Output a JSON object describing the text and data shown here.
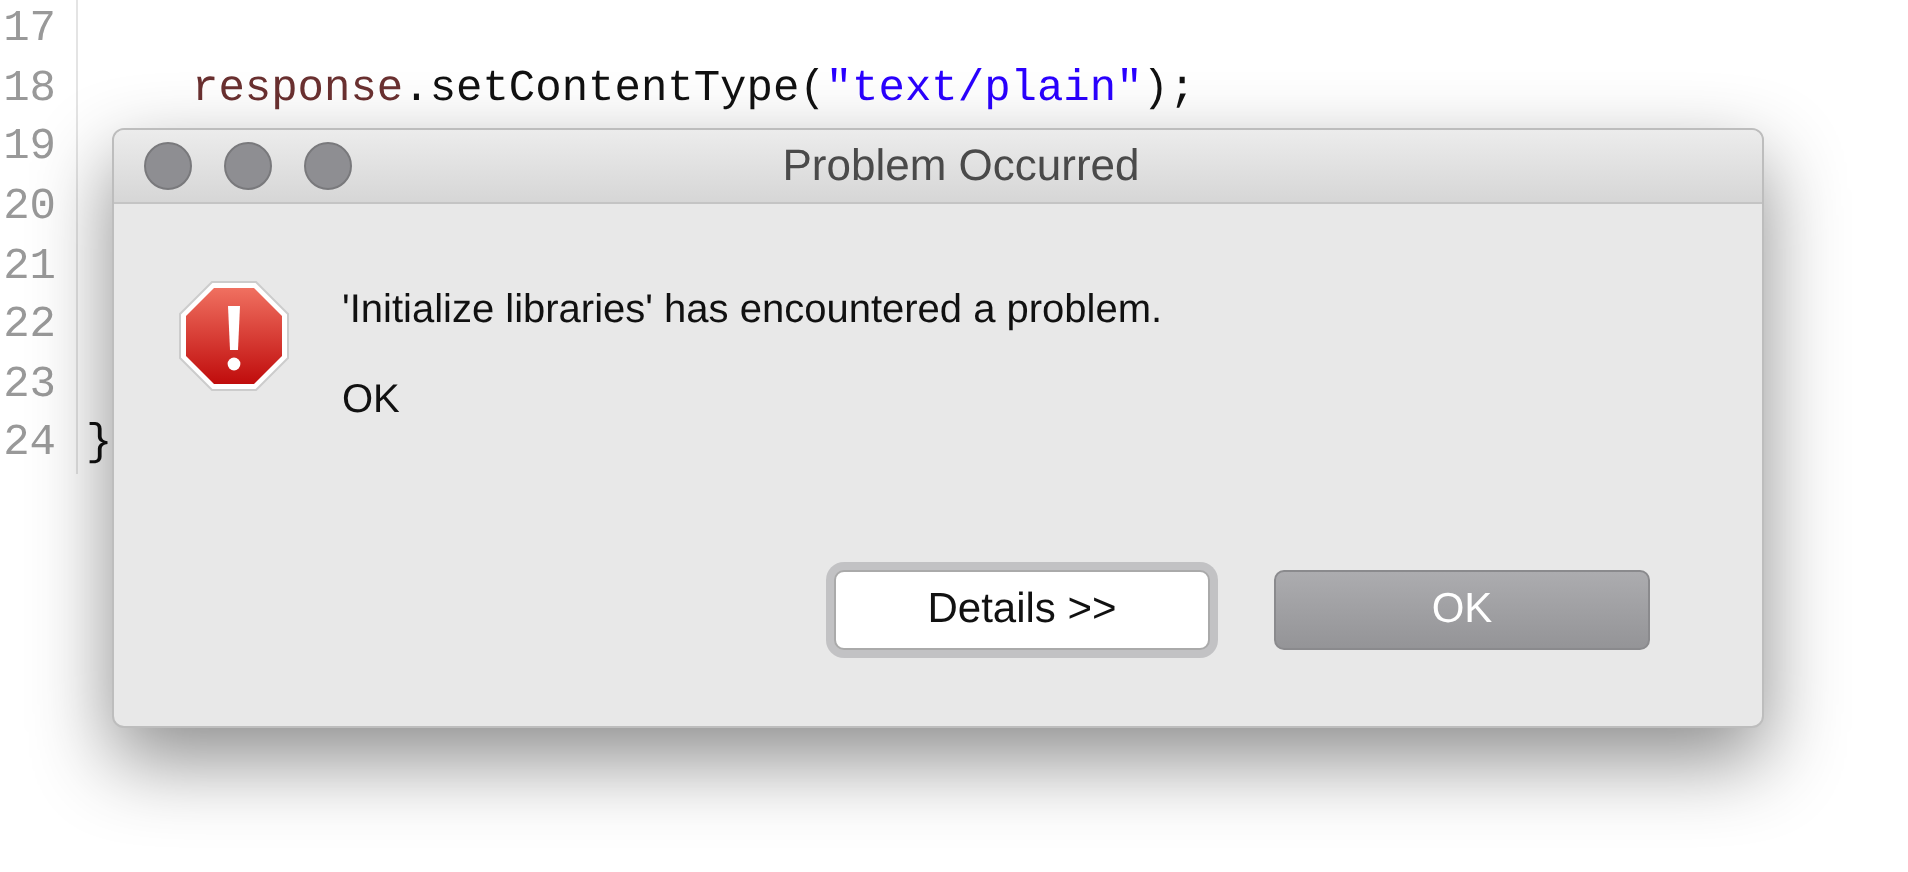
{
  "editor": {
    "lines": [
      {
        "number": "17"
      },
      {
        "number": "18",
        "indented": true,
        "tokens": [
          {
            "kind": "variable",
            "text": "response"
          },
          {
            "kind": "plain",
            "text": ".setContentType("
          },
          {
            "kind": "string",
            "text": "\"text/plain\""
          },
          {
            "kind": "plain",
            "text": ");"
          }
        ]
      },
      {
        "number": "19"
      },
      {
        "number": "20"
      },
      {
        "number": "21"
      },
      {
        "number": "22"
      },
      {
        "number": "23"
      },
      {
        "number": "24",
        "indented": false,
        "tokens": [
          {
            "kind": "plain",
            "text": "}"
          }
        ]
      }
    ]
  },
  "dialog": {
    "title": "Problem Occurred",
    "message": "'Initialize libraries' has encountered a problem.",
    "detail": "OK",
    "buttons": [
      {
        "label": "Details >>",
        "focused": true,
        "default": false
      },
      {
        "label": "OK",
        "focused": false,
        "default": true
      }
    ]
  }
}
